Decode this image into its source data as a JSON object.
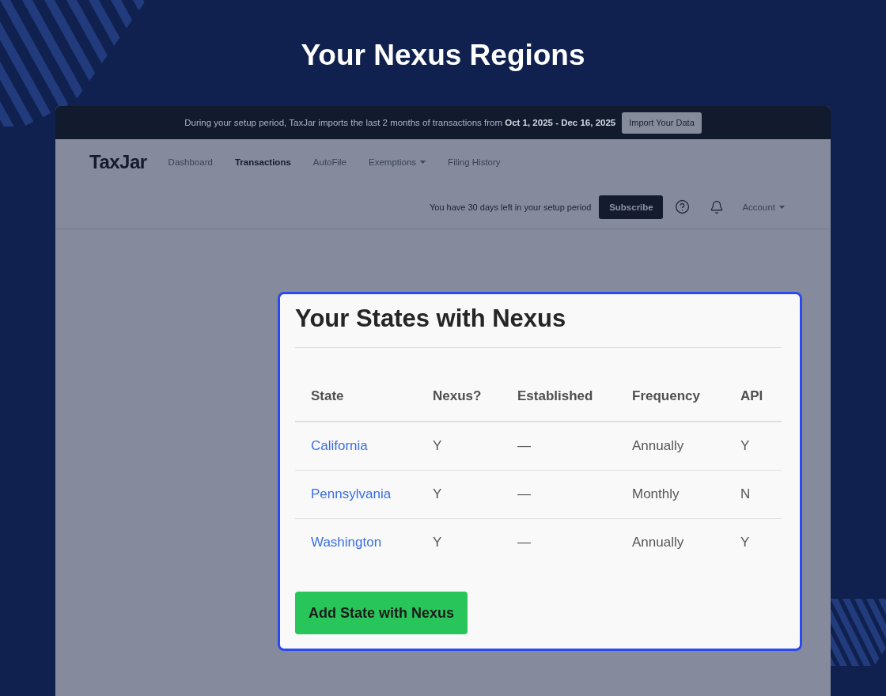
{
  "heading": "Your Nexus Regions",
  "banner": {
    "message": "During your setup period, TaxJar imports the last 2 months of transactions from **Oct 1, 2025 - Dec 16, 2025**",
    "button": "Import Your Data"
  },
  "nav": {
    "logo": "TaxJar",
    "items": [
      {
        "label": "Dashboard",
        "kind": "link",
        "selected": false
      },
      {
        "label": "Transactions",
        "kind": "link",
        "selected": true
      },
      {
        "label": "AutoFile",
        "kind": "link",
        "selected": false
      },
      {
        "label": "Exemptions",
        "kind": "dropdown",
        "selected": false
      },
      {
        "label": "Filing History",
        "kind": "link",
        "selected": false
      }
    ]
  },
  "setup_bar": {
    "notice": "You have 30 days left in your setup period",
    "button": "Subscribe",
    "account": "Account"
  },
  "card": {
    "title": "Your States with Nexus",
    "table": {
      "columns": [
        "State",
        "Nexus?",
        "Established",
        "Frequency",
        "API"
      ],
      "rows": [
        [
          "California",
          "Y",
          "—",
          "Annually",
          "Y"
        ],
        [
          "Pennsylvania",
          "Y",
          "—",
          "Monthly",
          "N"
        ],
        [
          "Washington",
          "Y",
          "—",
          "Annually",
          "Y"
        ]
      ]
    },
    "button": "Add State with Nexus"
  }
}
